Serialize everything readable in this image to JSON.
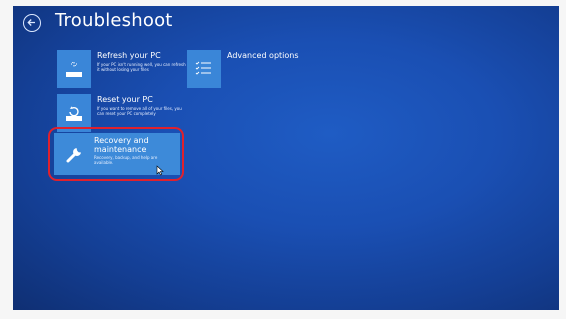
{
  "screen": {
    "title": "Troubleshoot",
    "back_icon": "back-arrow-circle-icon"
  },
  "tiles": [
    {
      "id": "refresh",
      "label": "Refresh your PC",
      "description": "If your PC isn't running well, you can refresh it without losing your files",
      "icon": "refresh-pc-icon"
    },
    {
      "id": "reset",
      "label": "Reset your PC",
      "description": "If you want to remove all of your files, you can reset your PC completely",
      "icon": "reset-pc-icon"
    },
    {
      "id": "recovery",
      "label": "Recovery and maintenance",
      "description": "Recovery, backup, and help are available.",
      "icon": "wrench-icon",
      "selected": true
    },
    {
      "id": "advanced",
      "label": "Advanced options",
      "description": "",
      "icon": "checklist-icon"
    }
  ],
  "colors": {
    "background": "#1a4fb3",
    "tile_icon_bg": "#3a86d8",
    "selected_tile_bg": "#3d8ad9",
    "highlight": "#e0212d",
    "text": "#ffffff"
  }
}
